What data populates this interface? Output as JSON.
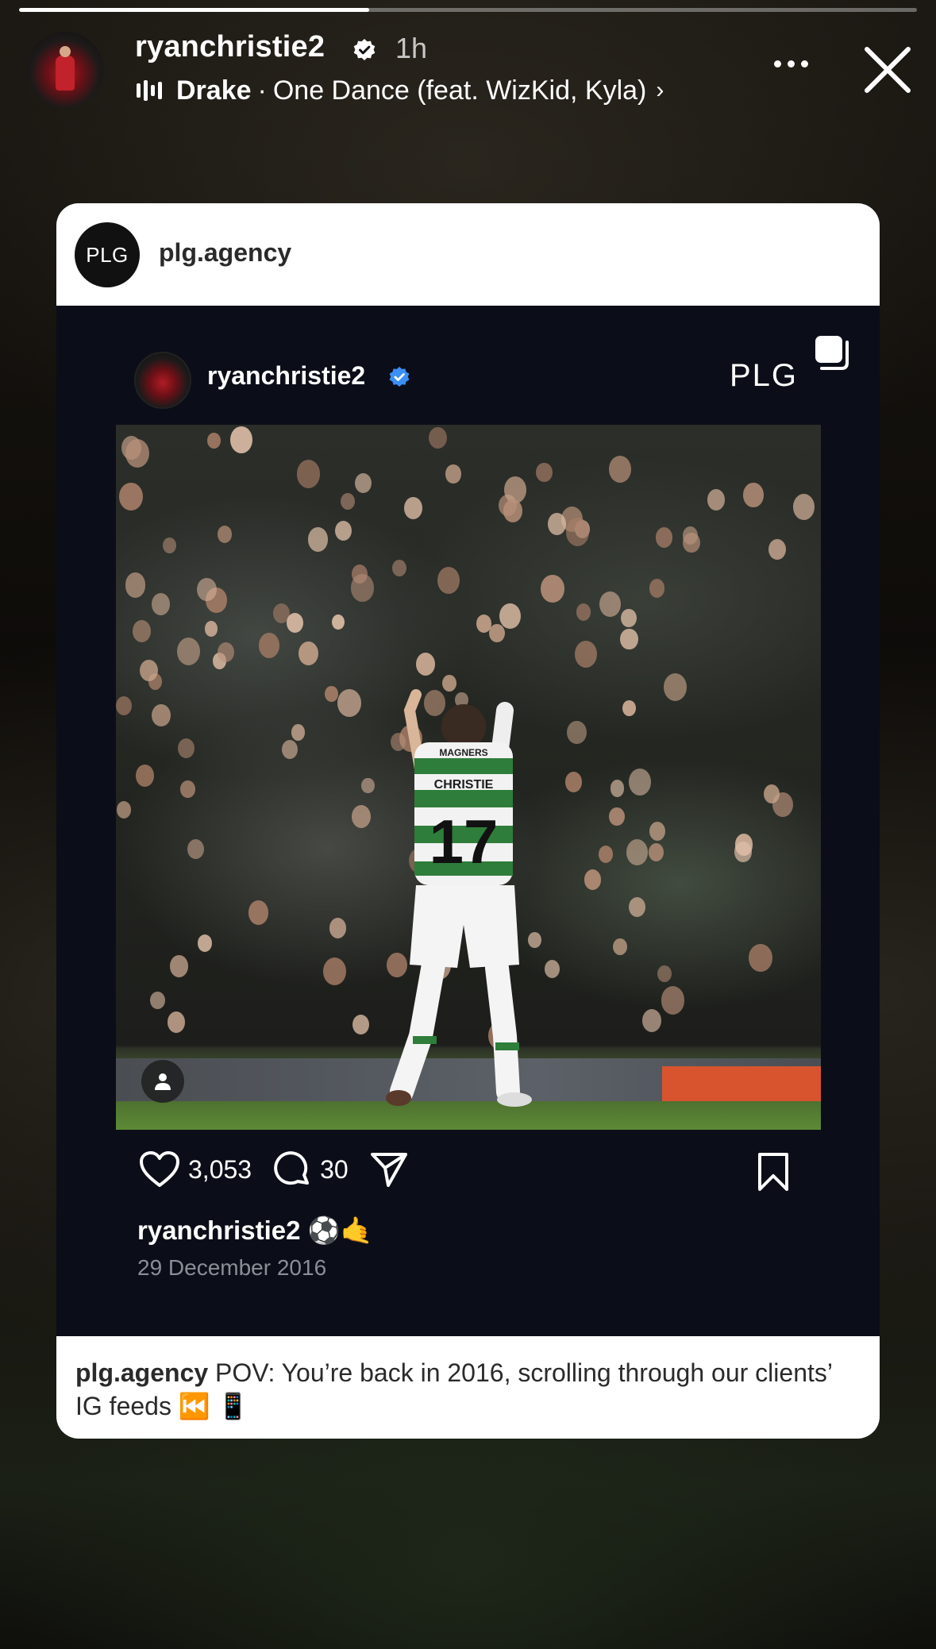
{
  "story": {
    "progress": 0.39,
    "username": "ryanchristie2",
    "time": "1h",
    "music": {
      "artist": "Drake",
      "separator": "·",
      "track": "One Dance (feat. WizKid, Kyla)",
      "chevron": "›"
    },
    "icons": {
      "verified": "verified-badge-icon",
      "equalizer": "equalizer-icon",
      "more": "more-options-icon",
      "close": "close-icon"
    }
  },
  "shared_post": {
    "account": "plg.agency",
    "avatar_text": "PLG",
    "inner_post": {
      "username": "ryanchristie2",
      "brand": "PLG",
      "likes": "3,053",
      "comments": "30",
      "caption_user": "ryanchristie2",
      "caption_emoji": "⚽🤙",
      "date": "29 December 2016",
      "jersey_name": "CHRISTIE",
      "jersey_number": "17",
      "sponsor": "MAGNERS"
    },
    "caption": {
      "user": "plg.agency",
      "text": " POV: You’re back in 2016, scrolling through our clients’ IG feeds ⏮️ 📱"
    }
  },
  "colors": {
    "verified": "#3b8ff5",
    "card_dark": "#0b0e18",
    "jersey_green": "#2f7d3a"
  }
}
